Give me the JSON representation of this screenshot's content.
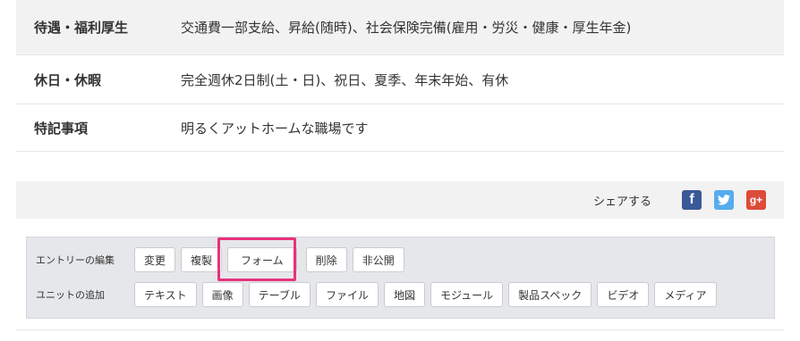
{
  "info_table": {
    "rows": [
      {
        "label": "待遇・福利厚生",
        "value": "交通費一部支給、昇給(随時)、社会保険完備(雇用・労災・健康・厚生年金)"
      },
      {
        "label": "休日・休暇",
        "value": "完全週休2日制(土・日)、祝日、夏季、年末年始、有休"
      },
      {
        "label": "特記事項",
        "value": "明るくアットホームな職場です"
      }
    ]
  },
  "share": {
    "label": "シェアする",
    "facebook_glyph": "f",
    "twitter_glyph": "🐦",
    "googleplus_glyph": "g+",
    "colors": {
      "facebook": "#3b5998",
      "twitter": "#55acee",
      "googleplus": "#dd4b39"
    }
  },
  "admin": {
    "entry_edit": {
      "label": "エントリーの編集",
      "buttons": [
        "変更",
        "複製",
        "フォーム",
        "削除",
        "非公開"
      ]
    },
    "unit_add": {
      "label": "ユニットの追加",
      "buttons": [
        "テキスト",
        "画像",
        "テーブル",
        "ファイル",
        "地図",
        "モジュール",
        "製品スペック",
        "ビデオ",
        "メディア"
      ]
    },
    "highlight_color": "#e8327c"
  }
}
